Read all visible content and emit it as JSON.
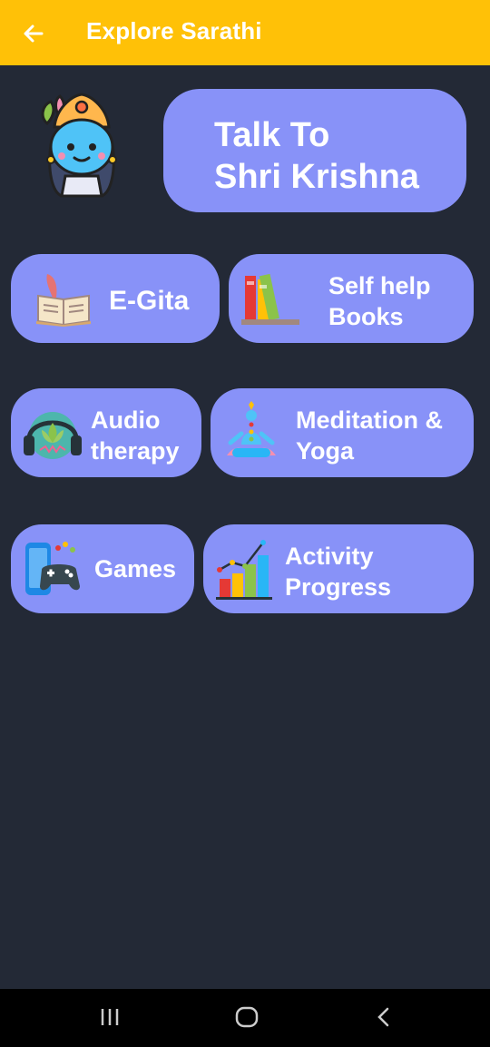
{
  "appbar": {
    "title": "Explore Sarathi"
  },
  "talk_card": {
    "line1": "Talk To",
    "line2": "Shri Krishna"
  },
  "tiles": [
    {
      "line1": "E-Gita",
      "line2": ""
    },
    {
      "line1": "Self help",
      "line2": "Books"
    },
    {
      "line1": "Audio",
      "line2": "therapy"
    },
    {
      "line1": "Meditation &",
      "line2": "Yoga"
    },
    {
      "line1": "Games",
      "line2": ""
    },
    {
      "line1": "Activity",
      "line2": "Progress"
    }
  ],
  "colors": {
    "appbar": "#FFC107",
    "background": "#232936",
    "card": "#8892F8"
  },
  "icons": {
    "back": "arrow-left-icon",
    "krishna": "krishna-avatar-icon",
    "egita": "open-book-quill-icon",
    "books": "books-stack-icon",
    "audio": "headphones-lotus-icon",
    "meditation": "meditation-yoga-icon",
    "games": "phone-gamepad-icon",
    "activity": "bar-chart-progress-icon"
  }
}
